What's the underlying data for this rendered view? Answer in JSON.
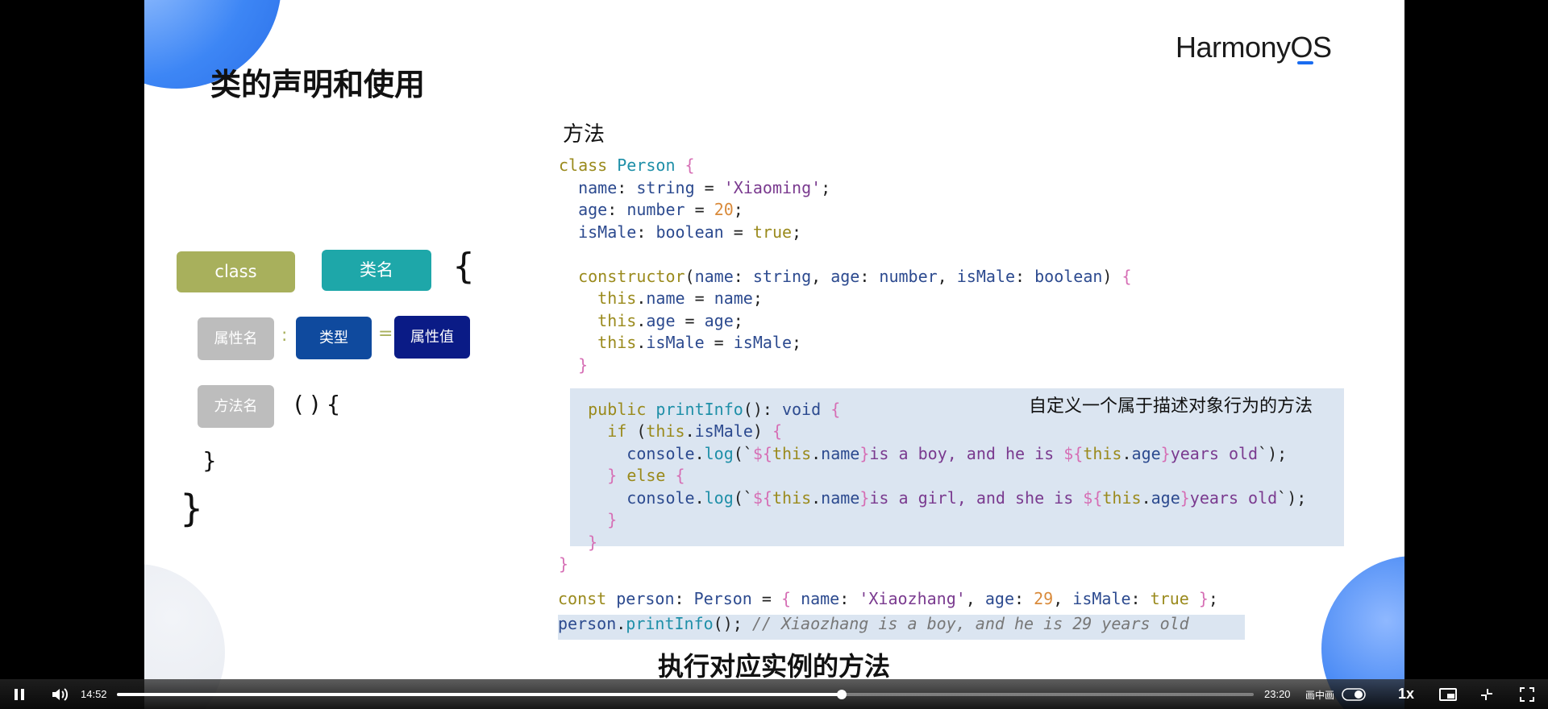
{
  "slide": {
    "title": "类的声明和使用",
    "logo_text": "HarmonyOS",
    "section_label": "方法",
    "annotation": "自定义一个属于描述对象行为的方法",
    "subtitle": "执行对应实例的方法"
  },
  "diagram": {
    "class_label": "class",
    "class_name_label": "类名",
    "open_brace": "{",
    "prop_name_label": "属性名",
    "colon": ":",
    "type_label": "类型",
    "equals": "=",
    "prop_value_label": "属性值",
    "method_name_label": "方法名",
    "method_parens": "( ) {",
    "method_close": "}",
    "class_close": "}",
    "colors": {
      "class_pill": "#a8b05c",
      "class_name_pill": "#1ea7a9",
      "prop_name_pill": "#bdbdbd",
      "type_pill": "#0f4a9e",
      "prop_value_pill": "#0a1b86",
      "method_name_pill": "#bdbdbd"
    }
  },
  "code": {
    "lines": [
      [
        [
          "kw",
          "class "
        ],
        [
          "ty",
          "Person "
        ],
        [
          "br",
          "{"
        ]
      ],
      [
        [
          "tx",
          "  "
        ],
        [
          "pr",
          "name"
        ],
        [
          "tx",
          ": "
        ],
        [
          "pr",
          "string"
        ],
        [
          "tx",
          " = "
        ],
        [
          "st",
          "'Xiaoming'"
        ],
        [
          "tx",
          ";"
        ]
      ],
      [
        [
          "tx",
          "  "
        ],
        [
          "pr",
          "age"
        ],
        [
          "tx",
          ": "
        ],
        [
          "pr",
          "number"
        ],
        [
          "tx",
          " = "
        ],
        [
          "nm",
          "20"
        ],
        [
          "tx",
          ";"
        ]
      ],
      [
        [
          "tx",
          "  "
        ],
        [
          "pr",
          "isMale"
        ],
        [
          "tx",
          ": "
        ],
        [
          "pr",
          "boolean"
        ],
        [
          "tx",
          " = "
        ],
        [
          "bl",
          "true"
        ],
        [
          "tx",
          ";"
        ]
      ],
      [
        [
          "tx",
          ""
        ]
      ],
      [
        [
          "tx",
          "  "
        ],
        [
          "kw",
          "constructor"
        ],
        [
          "tx",
          "("
        ],
        [
          "pr",
          "name"
        ],
        [
          "tx",
          ": "
        ],
        [
          "pr",
          "string"
        ],
        [
          "tx",
          ", "
        ],
        [
          "pr",
          "age"
        ],
        [
          "tx",
          ": "
        ],
        [
          "pr",
          "number"
        ],
        [
          "tx",
          ", "
        ],
        [
          "pr",
          "isMale"
        ],
        [
          "tx",
          ": "
        ],
        [
          "pr",
          "boolean"
        ],
        [
          "tx",
          ") "
        ],
        [
          "br",
          "{"
        ]
      ],
      [
        [
          "tx",
          "    "
        ],
        [
          "kw",
          "this"
        ],
        [
          "tx",
          "."
        ],
        [
          "pr",
          "name"
        ],
        [
          "tx",
          " = "
        ],
        [
          "pr",
          "name"
        ],
        [
          "tx",
          ";"
        ]
      ],
      [
        [
          "tx",
          "    "
        ],
        [
          "kw",
          "this"
        ],
        [
          "tx",
          "."
        ],
        [
          "pr",
          "age"
        ],
        [
          "tx",
          " = "
        ],
        [
          "pr",
          "age"
        ],
        [
          "tx",
          ";"
        ]
      ],
      [
        [
          "tx",
          "    "
        ],
        [
          "kw",
          "this"
        ],
        [
          "tx",
          "."
        ],
        [
          "pr",
          "isMale"
        ],
        [
          "tx",
          " = "
        ],
        [
          "pr",
          "isMale"
        ],
        [
          "tx",
          ";"
        ]
      ],
      [
        [
          "tx",
          "  "
        ],
        [
          "br",
          "}"
        ]
      ],
      [
        [
          "tx",
          ""
        ]
      ],
      [
        [
          "tx",
          "   "
        ],
        [
          "kw",
          "public "
        ],
        [
          "fn",
          "printInfo"
        ],
        [
          "tx",
          "(): "
        ],
        [
          "pr",
          "void "
        ],
        [
          "br",
          "{"
        ]
      ],
      [
        [
          "tx",
          "     "
        ],
        [
          "kw",
          "if "
        ],
        [
          "tx",
          "("
        ],
        [
          "kw",
          "this"
        ],
        [
          "tx",
          "."
        ],
        [
          "pr",
          "isMale"
        ],
        [
          "tx",
          ") "
        ],
        [
          "br",
          "{"
        ]
      ],
      [
        [
          "tx",
          "       "
        ],
        [
          "pr",
          "console"
        ],
        [
          "tx",
          "."
        ],
        [
          "fn",
          "log"
        ],
        [
          "tx",
          "(`"
        ],
        [
          "br",
          "${"
        ],
        [
          "kw",
          "this"
        ],
        [
          "tx",
          "."
        ],
        [
          "pr",
          "name"
        ],
        [
          "br",
          "}"
        ],
        [
          "st",
          "is a boy, and he is "
        ],
        [
          "br",
          "${"
        ],
        [
          "kw",
          "this"
        ],
        [
          "tx",
          "."
        ],
        [
          "pr",
          "age"
        ],
        [
          "br",
          "}"
        ],
        [
          "st",
          "years old"
        ],
        [
          "tx",
          "`);"
        ]
      ],
      [
        [
          "tx",
          "     "
        ],
        [
          "br",
          "} "
        ],
        [
          "kw",
          "else "
        ],
        [
          "br",
          "{"
        ]
      ],
      [
        [
          "tx",
          "       "
        ],
        [
          "pr",
          "console"
        ],
        [
          "tx",
          "."
        ],
        [
          "fn",
          "log"
        ],
        [
          "tx",
          "(`"
        ],
        [
          "br",
          "${"
        ],
        [
          "kw",
          "this"
        ],
        [
          "tx",
          "."
        ],
        [
          "pr",
          "name"
        ],
        [
          "br",
          "}"
        ],
        [
          "st",
          "is a girl, and she is "
        ],
        [
          "br",
          "${"
        ],
        [
          "kw",
          "this"
        ],
        [
          "tx",
          "."
        ],
        [
          "pr",
          "age"
        ],
        [
          "br",
          "}"
        ],
        [
          "st",
          "years old"
        ],
        [
          "tx",
          "`);"
        ]
      ],
      [
        [
          "tx",
          "     "
        ],
        [
          "br",
          "}"
        ]
      ],
      [
        [
          "tx",
          "   "
        ],
        [
          "br",
          "}"
        ]
      ],
      [
        [
          "br",
          "}"
        ]
      ]
    ],
    "usage_lines": [
      [
        [
          "kw",
          "const "
        ],
        [
          "pr",
          "person"
        ],
        [
          "tx",
          ": "
        ],
        [
          "pr",
          "Person"
        ],
        [
          "tx",
          " = "
        ],
        [
          "br",
          "{ "
        ],
        [
          "pr",
          "name"
        ],
        [
          "tx",
          ": "
        ],
        [
          "st",
          "'Xiaozhang'"
        ],
        [
          "tx",
          ", "
        ],
        [
          "pr",
          "age"
        ],
        [
          "tx",
          ": "
        ],
        [
          "nm",
          "29"
        ],
        [
          "tx",
          ", "
        ],
        [
          "pr",
          "isMale"
        ],
        [
          "tx",
          ": "
        ],
        [
          "bl",
          "true "
        ],
        [
          "br",
          "}"
        ],
        [
          "tx",
          ";"
        ]
      ],
      [
        [
          "pr",
          "person"
        ],
        [
          "tx",
          "."
        ],
        [
          "fn",
          "printInfo"
        ],
        [
          "tx",
          "(); "
        ],
        [
          "cm",
          "// Xiaozhang is a boy, and he is 29 years old"
        ]
      ]
    ]
  },
  "player": {
    "current_time": "14:52",
    "total_time": "23:20",
    "progress_fraction": 0.6373,
    "pip_label": "画中画",
    "speed_label": "1x",
    "pause_icon": "pause-icon",
    "volume_icon": "volume-icon",
    "pip_toggle_icon": "toggle-icon",
    "miniplayer_icon": "miniplayer-icon",
    "exit_fullscreen_icon": "exit-fullscreen-icon",
    "fullscreen_icon": "fullscreen-icon"
  }
}
